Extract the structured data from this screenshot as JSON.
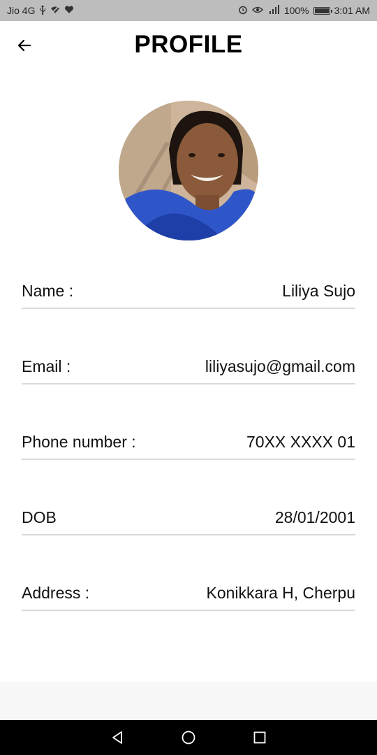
{
  "status_bar": {
    "carrier": "Jio 4G",
    "left_icons": [
      "usb-icon",
      "wifi-off-icon",
      "heart-icon"
    ],
    "right_icons": [
      "alarm-icon",
      "eye-icon",
      "signal-4g-icon"
    ],
    "battery_percent_text": "100%",
    "battery_level": 1.0,
    "time": "3:01 AM"
  },
  "header": {
    "title": "PROFILE",
    "back_icon": "arrow-left-icon"
  },
  "avatar": {
    "icon": "profile-photo"
  },
  "fields": [
    {
      "label": "Name :",
      "value": "Liliya Sujo"
    },
    {
      "label": "Email :",
      "value": "liliyasujo@gmail.com"
    },
    {
      "label": "Phone number :",
      "value": "70XX XXXX 01"
    },
    {
      "label": "DOB",
      "value": "28/01/2001"
    },
    {
      "label": "Address :",
      "value": "Konikkara H, Cherpu"
    }
  ],
  "nav_bar": {
    "icons": [
      "back-triangle-icon",
      "home-circle-icon",
      "recents-square-icon"
    ]
  },
  "colors": {
    "status_bar_bg": "#bdbdbd",
    "divider": "#dadada",
    "nav_bar_bg": "#000000"
  }
}
